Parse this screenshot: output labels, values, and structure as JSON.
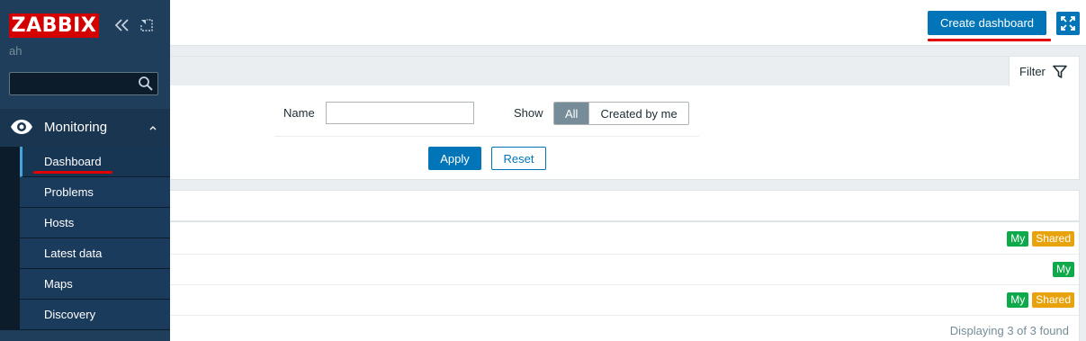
{
  "sidebar": {
    "logo_text": "ZABBIX",
    "server_name": "ah",
    "search": {
      "value": "",
      "placeholder": ""
    },
    "section": {
      "label": "Monitoring",
      "icon": "eye-icon",
      "expanded": true
    },
    "items": [
      {
        "label": "Dashboard",
        "selected": true
      },
      {
        "label": "Problems"
      },
      {
        "label": "Hosts"
      },
      {
        "label": "Latest data"
      },
      {
        "label": "Maps"
      },
      {
        "label": "Discovery"
      }
    ]
  },
  "header": {
    "create_label": "Create dashboard",
    "kiosk_icon": "fullscreen-icon"
  },
  "filter": {
    "tab_label": "Filter",
    "name_label": "Name",
    "name_value": "",
    "show_label": "Show",
    "show_options": [
      "All",
      "Created by me"
    ],
    "show_selected": "All",
    "apply_label": "Apply",
    "reset_label": "Reset"
  },
  "list": {
    "rows": [
      {
        "tags": [
          "My",
          "Shared"
        ]
      },
      {
        "tags": [
          "My"
        ]
      },
      {
        "tags": [
          "My",
          "Shared"
        ]
      }
    ],
    "footer": "Displaying 3 of 3 found"
  },
  "colors": {
    "sidebar": "#1f3e5c",
    "accent": "#0275b8",
    "logo": "#d40000",
    "tag_my": "#0ea94a",
    "tag_shared": "#e8a20b",
    "highlight_underline": "#e30000"
  }
}
